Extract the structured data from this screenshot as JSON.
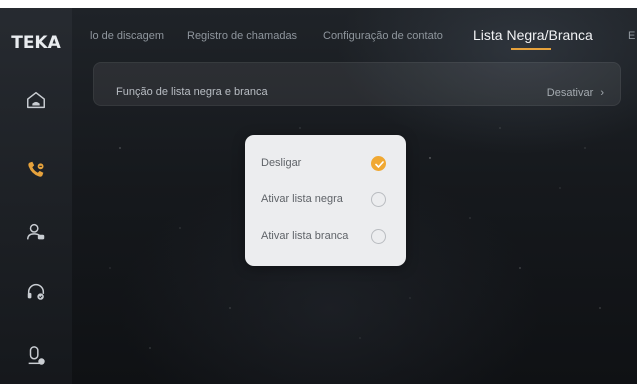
{
  "app": {
    "logo": "TEKA"
  },
  "sidebar": {
    "items": [
      {
        "icon": "home-phone-icon",
        "active": false
      },
      {
        "icon": "phone-icon",
        "active": true
      },
      {
        "icon": "contacts-icon",
        "active": false
      },
      {
        "icon": "headset-icon",
        "active": false
      },
      {
        "icon": "voicemail-icon",
        "active": false
      }
    ]
  },
  "tabs": [
    {
      "label": "lo de discagem",
      "active": false
    },
    {
      "label": "Registro de chamadas",
      "active": false
    },
    {
      "label": "Configuração de contato",
      "active": false
    },
    {
      "label": "Lista Negra/Branca",
      "active": true
    },
    {
      "label": "E",
      "active": false
    }
  ],
  "function_row": {
    "label": "Função de lista negra e branca",
    "value": "Desativar",
    "chevron": "chevron-right-icon"
  },
  "dialog": {
    "options": [
      {
        "label": "Desligar",
        "selected": true
      },
      {
        "label": "Ativar lista negra",
        "selected": false
      },
      {
        "label": "Ativar lista branca",
        "selected": false
      }
    ]
  },
  "colors": {
    "accent": "#f0a832",
    "active_icon": "#e6a23c",
    "inactive_icon": "#c9cdd2"
  }
}
